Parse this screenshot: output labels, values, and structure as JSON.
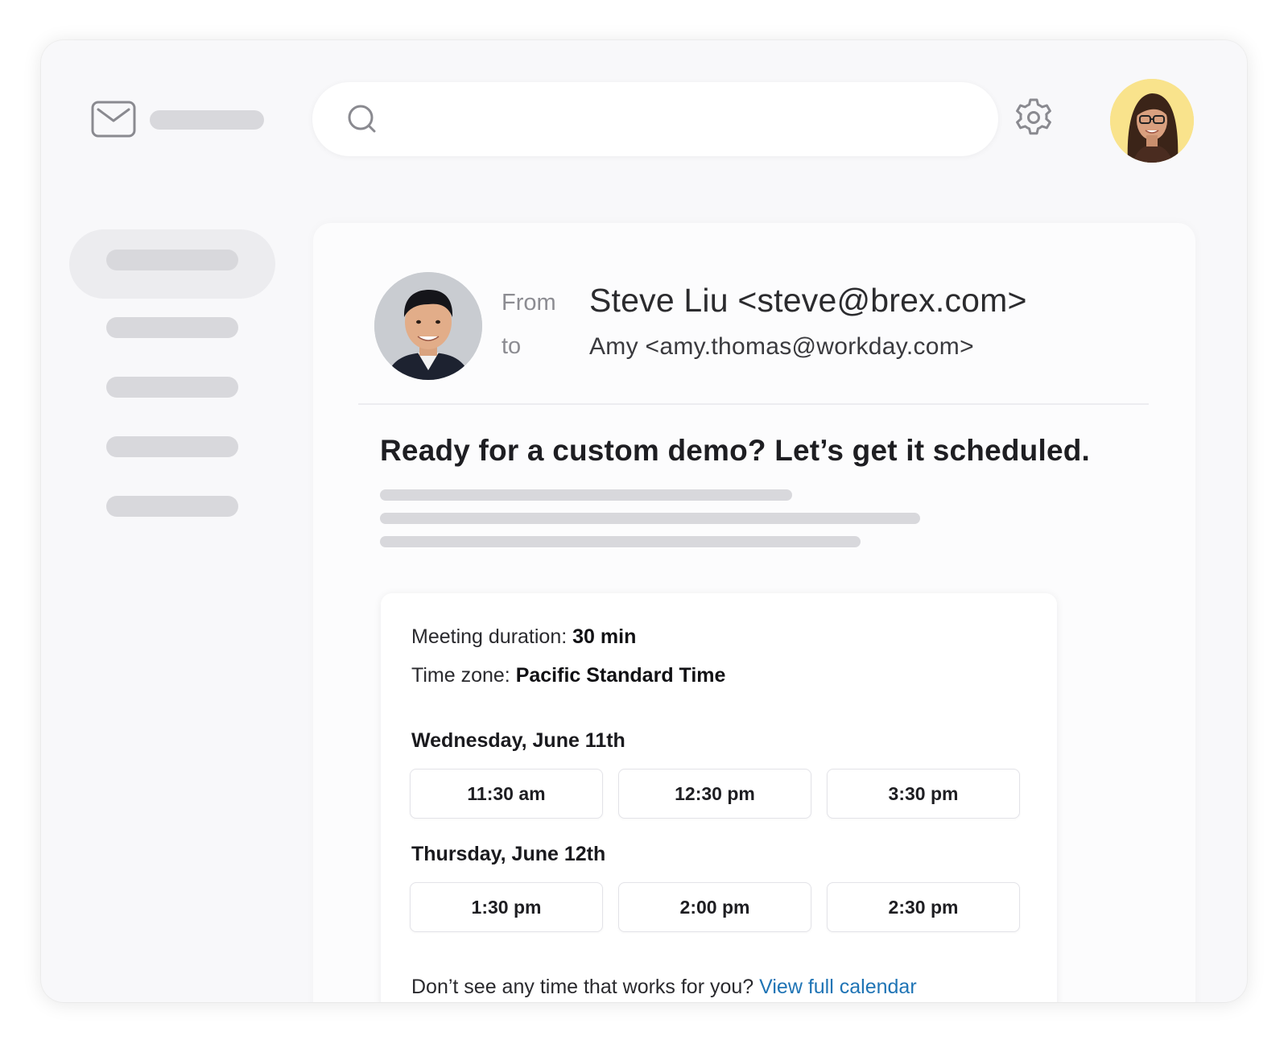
{
  "email": {
    "from_label": "From",
    "to_label": "to",
    "from_value": "Steve Liu <steve@brex.com>",
    "to_value": "Amy <amy.thomas@workday.com>",
    "subject": "Ready for a custom demo? Let’s get it scheduled."
  },
  "scheduler": {
    "duration_label": "Meeting duration:",
    "duration_value": "30 min",
    "timezone_label": "Time zone:",
    "timezone_value": "Pacific Standard Time",
    "days": [
      {
        "label": "Wednesday, June 11th",
        "slots": [
          "11:30 am",
          "12:30 pm",
          "3:30 pm"
        ]
      },
      {
        "label": "Thursday, June 12th",
        "slots": [
          "1:30 pm",
          "2:00 pm",
          "2:30 pm"
        ]
      }
    ],
    "footer_text": "Don’t see any time that works for you?",
    "calendar_link": "View full calendar"
  },
  "colors": {
    "link": "#1f74b5",
    "user_avatar_bg": "#f9e38c",
    "placeholder_pill": "#d8d8dc"
  },
  "icons": {
    "app": "mail-icon",
    "search": "search-icon",
    "settings": "gear-icon"
  }
}
